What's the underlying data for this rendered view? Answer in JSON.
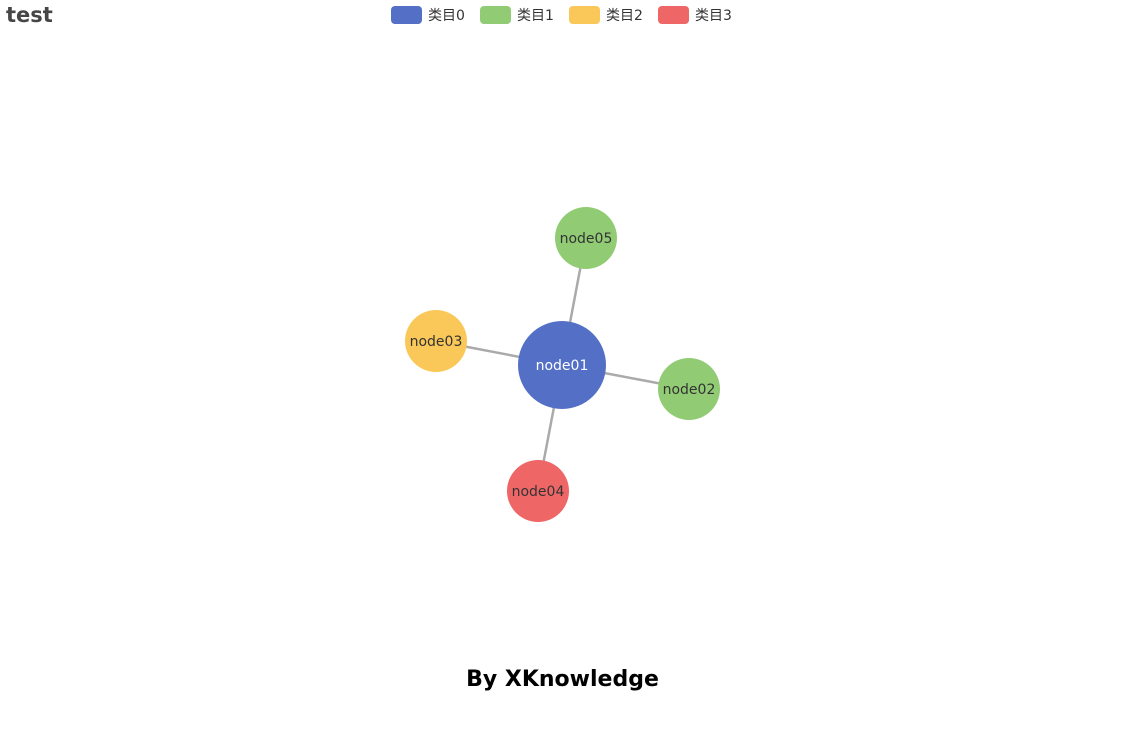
{
  "title": "test",
  "legend": [
    {
      "label": "类目0",
      "color": "#5470c6"
    },
    {
      "label": "类目1",
      "color": "#91cc75"
    },
    {
      "label": "类目2",
      "color": "#fac858"
    },
    {
      "label": "类目3",
      "color": "#ee6666"
    }
  ],
  "graph": {
    "nodes": [
      {
        "id": "node01",
        "label": "node01",
        "category": 0,
        "label_color": "#ffffff"
      },
      {
        "id": "node02",
        "label": "node02",
        "category": 1,
        "label_color": "#333333"
      },
      {
        "id": "node03",
        "label": "node03",
        "category": 2,
        "label_color": "#333333"
      },
      {
        "id": "node04",
        "label": "node04",
        "category": 3,
        "label_color": "#333333"
      },
      {
        "id": "node05",
        "label": "node05",
        "category": 1,
        "label_color": "#333333"
      }
    ],
    "edges": [
      {
        "source": "node01",
        "target": "node02"
      },
      {
        "source": "node01",
        "target": "node03"
      },
      {
        "source": "node01",
        "target": "node04"
      },
      {
        "source": "node01",
        "target": "node05"
      }
    ],
    "edge_color": "#aaaaaa"
  },
  "footer": "By XKnowledge"
}
